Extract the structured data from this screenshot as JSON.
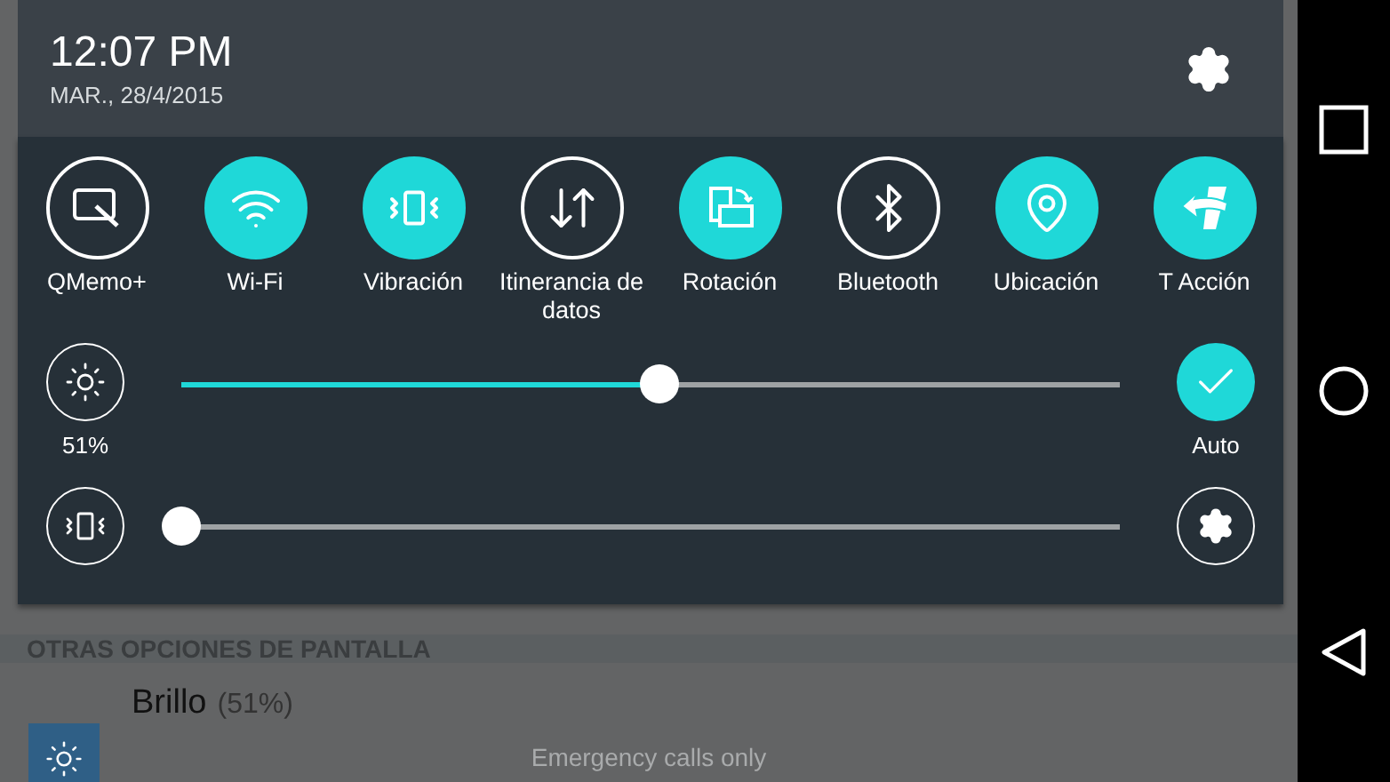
{
  "status": {
    "time": "12:07 PM",
    "date": "MAR., 28/4/2015"
  },
  "toggles": [
    {
      "kind": "qmemo",
      "label": "QMemo+",
      "on": false
    },
    {
      "kind": "wifi",
      "label": "Wi-Fi",
      "on": true
    },
    {
      "kind": "vibrate",
      "label": "Vibración",
      "on": true
    },
    {
      "kind": "roaming",
      "label": "Itinerancia de datos",
      "on": false
    },
    {
      "kind": "rotation",
      "label": "Rotación",
      "on": true
    },
    {
      "kind": "bluetooth",
      "label": "Bluetooth",
      "on": false
    },
    {
      "kind": "location",
      "label": "Ubicación",
      "on": true
    },
    {
      "kind": "action",
      "label": "T Acción",
      "on": true
    }
  ],
  "brightness": {
    "reading": "51%",
    "level": 0.51,
    "auto": {
      "label": "Auto",
      "on": true
    }
  },
  "vibration": {
    "level": 0
  },
  "background_page": {
    "section_title": "OTRAS OPCIONES DE PANTALLA",
    "item": {
      "title": "Brillo",
      "value": "(51%)"
    }
  },
  "status_message": "Emergency calls only"
}
